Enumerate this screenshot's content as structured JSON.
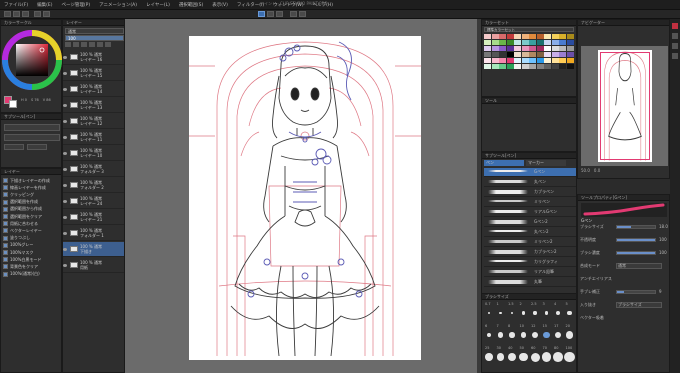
{
  "window_title": "ペイント - CLIP STUDIO PAINT PRO",
  "menu": [
    "ファイル(F)",
    "編集(E)",
    "ページ管理(P)",
    "アニメーション(A)",
    "レイヤー(L)",
    "選択範囲(S)",
    "表示(V)",
    "フィルター(I)",
    "ウィンドウ(W)",
    "ヘルプ(H)"
  ],
  "color_panel": {
    "title": "カラーサークル",
    "values": [
      "H 0",
      "S 76",
      "V 86"
    ]
  },
  "tool_panel": {
    "title": "サブツール[ペン]"
  },
  "left_layer_list": {
    "title": "レイヤー",
    "items": [
      "下描きレイヤーの作成",
      "線画レイヤーを作成",
      "クリッピング",
      "選択範囲を作成",
      "選択範囲から作成",
      "選択範囲をクリア",
      "用紙に合わせる",
      "ベクターレイヤー",
      "塗りつぶし",
      "100%グレー",
      "100%マスク",
      "100%白黒モード",
      "背景色をクリア",
      "100%(通常)(白)"
    ]
  },
  "layer_panel": {
    "title": "レイヤー",
    "blend_mode": "通常",
    "opacity": "100",
    "layers": [
      {
        "name": "100 % 通常",
        "sub": "レイヤー 16"
      },
      {
        "name": "100 % 通常",
        "sub": "レイヤー 15"
      },
      {
        "name": "100 % 通常",
        "sub": "レイヤー 14"
      },
      {
        "name": "100 % 通常",
        "sub": "レイヤー 13"
      },
      {
        "name": "100 % 通常",
        "sub": "レイヤー 12"
      },
      {
        "name": "100 % 通常",
        "sub": "レイヤー 11"
      },
      {
        "name": "100 % 通常",
        "sub": "レイヤー 10"
      },
      {
        "name": "100 % 通常",
        "sub": "フォルダー 3"
      },
      {
        "name": "100 % 通常",
        "sub": "フォルダー 2"
      },
      {
        "name": "100 % 通常",
        "sub": "レイヤー 24"
      },
      {
        "name": "100 % 通常",
        "sub": "レイヤー 21"
      },
      {
        "name": "100 % 通常",
        "sub": "フォルダー 1"
      },
      {
        "name": "100 % 通常",
        "sub": "下描き"
      },
      {
        "name": "100 % 通常",
        "sub": "用紙"
      }
    ]
  },
  "color_set": {
    "title": "カラーセット",
    "set_name": "標準カラーセット"
  },
  "subtool_panel": {
    "title": "サブツール[ペン]",
    "tabs": [
      "ペン",
      "マーカー"
    ],
    "brushes": [
      "Gペン",
      "丸ペン",
      "カブラペン",
      "ミリペン",
      "リアルGペン",
      "Gペン2",
      "丸ペン2",
      "ミリペン2",
      "カブラペン2",
      "カリグラフィ",
      "リアル鉛筆",
      "丸筆"
    ]
  },
  "tool_property": {
    "title": "ツールプロパティ[Gペン]",
    "tool_name": "Gペン",
    "rows": [
      {
        "label": "ブラシサイズ",
        "value": "18.0",
        "fill": 0.36
      },
      {
        "label": "不透明度",
        "value": "100",
        "fill": 1.0
      },
      {
        "label": "ブラシ濃度",
        "value": "100",
        "fill": 1.0
      },
      {
        "label": "合成モード",
        "value": "通常"
      },
      {
        "label": "アンチエイリアス",
        "value": ""
      },
      {
        "label": "手ブレ補正",
        "value": "9",
        "fill": 0.18
      },
      {
        "label": "入り抜き",
        "value": "ブラシサイズ"
      },
      {
        "label": "ベクター吸着",
        "value": ""
      }
    ]
  },
  "brush_size_panel": {
    "title": "ブラシサイズ",
    "sizes": [
      "0.7",
      "1",
      "1.5",
      "2",
      "2.5",
      "3",
      "4",
      "5",
      "6",
      "7",
      "8",
      "10",
      "12",
      "15",
      "17",
      "20",
      "25",
      "30",
      "40",
      "50",
      "60",
      "70",
      "80",
      "100"
    ]
  },
  "navigator": {
    "title": "ナビゲーター",
    "zoom": "50.0",
    "angle": "0.0"
  },
  "colors": {
    "accent": "#3d6fb0",
    "pen_pink": "#e23a72",
    "sketch_red": "#d44b5c",
    "line_blue": "#5b5bb5"
  }
}
